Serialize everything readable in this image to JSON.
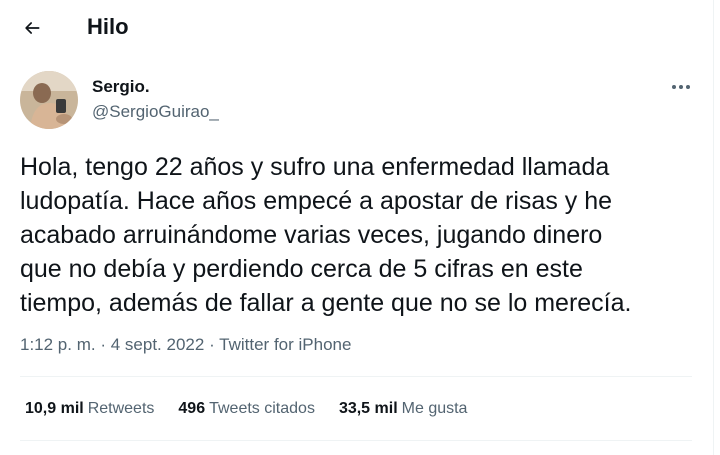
{
  "header": {
    "title": "Hilo",
    "back_icon": "arrow-left-icon"
  },
  "tweet": {
    "author": {
      "name": "Sergio.",
      "handle": "@SergioGuirao_"
    },
    "more_icon": "more-horizontal-icon",
    "text_lines": [
      "Hola, tengo 22 años y sufro una enfermedad llamada",
      "ludopatía. Hace años empecé a apostar de risas y he",
      "acabado arruinándome varias veces, jugando dinero",
      "que no debía y perdiendo cerca de 5 cifras en este",
      "tiempo, además de fallar a gente que no se lo merecía."
    ],
    "time": "1:12 p. m.",
    "separator": "·",
    "date": "4 sept. 2022",
    "source": "Twitter for iPhone"
  },
  "stats": [
    {
      "value": "10,9 mil",
      "label": "Retweets"
    },
    {
      "value": "496",
      "label": "Tweets citados"
    },
    {
      "value": "33,5 mil",
      "label": "Me gusta"
    }
  ],
  "colors": {
    "text": "#0f1419",
    "secondary": "#536471",
    "divider": "#eff3f4"
  }
}
